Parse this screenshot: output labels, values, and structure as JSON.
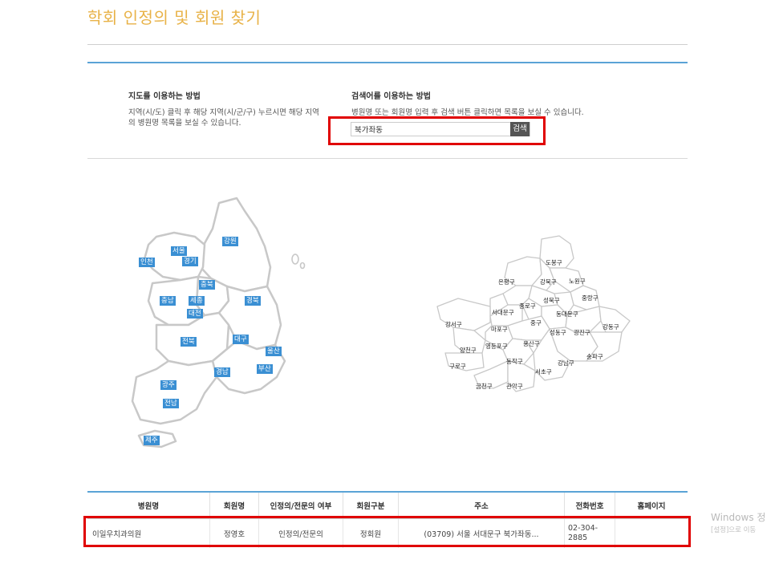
{
  "page": {
    "title": "학회 인정의 및 회원 찾기"
  },
  "howto": {
    "map": {
      "title": "지도를 이용하는 방법",
      "desc": "지역(시/도) 클릭 후 해당 지역(시/군/구) 누르시면 해당 지역의 병원명 목록을 보실 수 있습니다."
    },
    "search": {
      "title": "검색어를 이용하는 방법",
      "desc": "병원명 또는 회원명 입력 후 검색 버튼 클릭하면 목록을 보실 수 있습니다.",
      "input_value": "북가좌동",
      "button_label": "검색"
    }
  },
  "korea_map": {
    "regions": [
      "강원",
      "서울",
      "인천",
      "경기",
      "충북",
      "충남",
      "세종",
      "대전",
      "경북",
      "전북",
      "대구",
      "울산",
      "경남",
      "부산",
      "광주",
      "전남",
      "제주"
    ]
  },
  "seoul_map": {
    "districts": [
      "도봉구",
      "은평구",
      "강북구",
      "노원구",
      "성북구",
      "중랑구",
      "종로구",
      "서대문구",
      "동대문구",
      "강서구",
      "마포구",
      "중구",
      "성동구",
      "광진구",
      "강동구",
      "양천구",
      "영등포구",
      "용산구",
      "동작구",
      "강남구",
      "송파구",
      "구로구",
      "서초구",
      "금천구",
      "관악구"
    ]
  },
  "table": {
    "headers": [
      "병원명",
      "회원명",
      "인정의/전문의 여부",
      "회원구분",
      "주소",
      "전화번호",
      "홈페이지"
    ],
    "rows": [
      [
        "이일우치과의원",
        "정영호",
        "인정의/전문의",
        "정회원",
        "(03709) 서울 서대문구 북가좌동...",
        "02-304-2885",
        ""
      ]
    ]
  },
  "watermark": {
    "line1": "Windows 정",
    "line2": "[설정]으로 이동"
  }
}
